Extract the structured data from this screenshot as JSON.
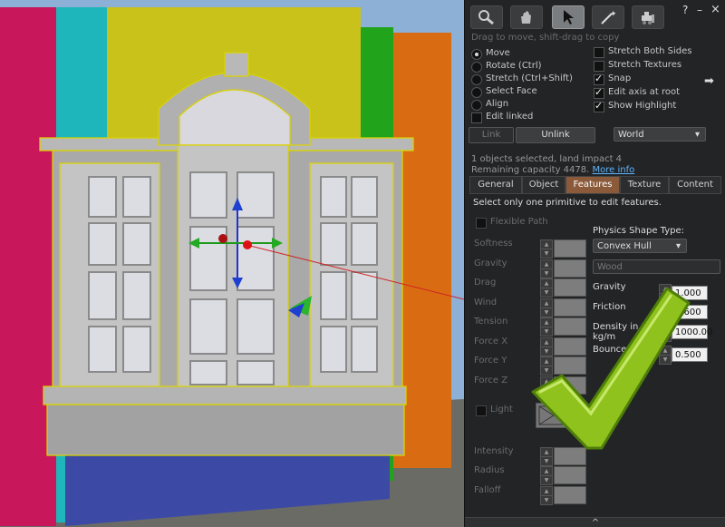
{
  "toolbar": {
    "tools": [
      {
        "name": "focus-tool",
        "icon": "magnifier-icon",
        "active": false
      },
      {
        "name": "grab-tool",
        "icon": "hand-icon",
        "active": false
      },
      {
        "name": "edit-tool",
        "icon": "arrow-cursor-icon",
        "active": true
      },
      {
        "name": "create-tool",
        "icon": "magic-wand-icon",
        "active": false
      },
      {
        "name": "land-tool",
        "icon": "bulldozer-icon",
        "active": false
      }
    ],
    "help": "?",
    "minimize": "–",
    "close": "×",
    "hint": "Drag to move, shift-drag to copy"
  },
  "edit_options": [
    {
      "label": "Move",
      "selected": true
    },
    {
      "label": "Rotate (Ctrl)",
      "selected": false
    },
    {
      "label": "Stretch (Ctrl+Shift)",
      "selected": false
    },
    {
      "label": "Select Face",
      "selected": false
    },
    {
      "label": "Align",
      "selected": false
    }
  ],
  "edit_linked": {
    "label": "Edit linked",
    "checked": false
  },
  "right_options": [
    {
      "label": "Stretch Both Sides",
      "checked": false
    },
    {
      "label": "Stretch Textures",
      "checked": false
    },
    {
      "label": "Snap",
      "checked": true
    },
    {
      "label": "Edit axis at root",
      "checked": true
    },
    {
      "label": "Show Highlight",
      "checked": true
    }
  ],
  "link_row": {
    "link": "Link",
    "unlink": "Unlink",
    "ruler": "World"
  },
  "status": {
    "line1": "1 objects selected, land impact 4",
    "line2": "Remaining capacity 4478.",
    "more_info": "More info"
  },
  "tabs": [
    {
      "label": "General",
      "active": false
    },
    {
      "label": "Object",
      "active": false
    },
    {
      "label": "Features",
      "active": true
    },
    {
      "label": "Texture",
      "active": false
    },
    {
      "label": "Content",
      "active": false
    }
  ],
  "features": {
    "note": "Select only one primitive to edit features.",
    "flexible_path": "Flexible Path",
    "flex_params": [
      "Softness",
      "Gravity",
      "Drag",
      "Wind",
      "Tension",
      "Force X",
      "Force Y",
      "Force Z"
    ],
    "light": "Light",
    "light_params": [
      "Intensity",
      "Radius",
      "Falloff"
    ],
    "physics_shape_label": "Physics Shape Type:",
    "physics_shape_value": "Convex Hull",
    "material": "Wood",
    "physics": [
      {
        "label": "Gravity",
        "value": "1.000"
      },
      {
        "label": "Friction",
        "value": "0.600"
      },
      {
        "label": "Density in 100 kg/m",
        "value": "1000.00"
      },
      {
        "label": "Bounce",
        "value": "0.500"
      }
    ]
  },
  "colors": {
    "panel": "#222425",
    "active_tab": "#8a5a3a",
    "checkmark": "#8fc21c",
    "link": "#5fb4ff"
  },
  "bottom_arrow": "^"
}
